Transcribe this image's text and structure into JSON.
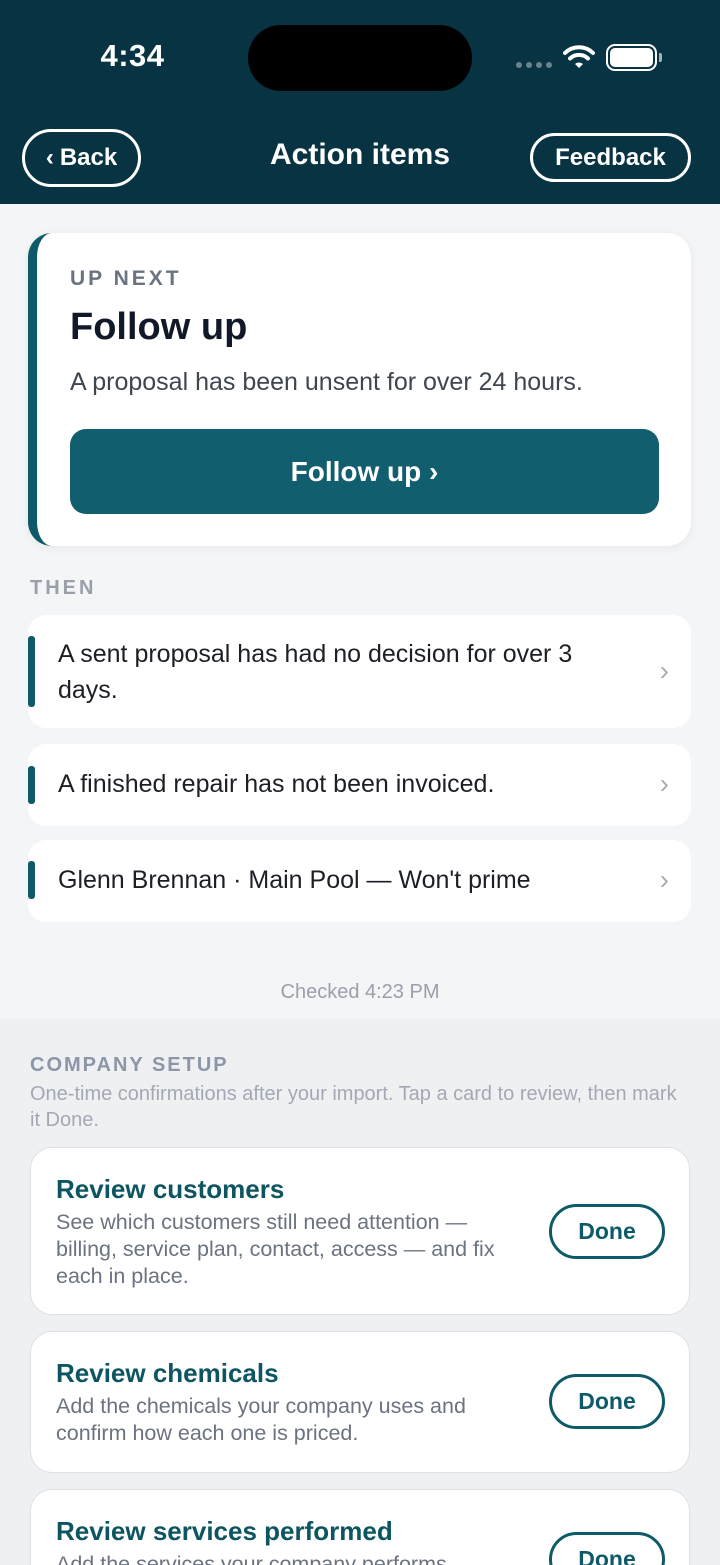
{
  "status_bar": {
    "time": "4:34"
  },
  "nav": {
    "back_label": "Back",
    "title": "Action items",
    "feedback_label": "Feedback"
  },
  "up_next": {
    "eyebrow": "UP NEXT",
    "title": "Follow up",
    "description": "A proposal has been unsent for over 24 hours.",
    "button_label": "Follow up ›"
  },
  "then": {
    "label": "THEN",
    "items": [
      {
        "text": "A sent proposal has had no decision for over 3 days."
      },
      {
        "text": "A finished repair has not been invoiced."
      },
      {
        "text": "Glenn Brennan · Main Pool — Won't prime"
      }
    ]
  },
  "checked_text": "Checked 4:23 PM",
  "company_setup": {
    "label": "COMPANY SETUP",
    "hint": "One-time confirmations after your import. Tap a card to review, then mark it Done.",
    "cards": [
      {
        "title": "Review customers",
        "description": "See which customers still need attention — billing, service plan, contact, access — and fix each in place.",
        "button_label": "Done"
      },
      {
        "title": "Review chemicals",
        "description": "Add the chemicals your company uses and confirm how each one is priced.",
        "button_label": "Done"
      },
      {
        "title": "Review services performed",
        "description": "Add the services your company performs",
        "button_label": "Done"
      }
    ]
  },
  "icons": {
    "back": "chevron-left-icon",
    "row": "chevron-right-icon",
    "wifi": "wifi-icon",
    "battery": "battery-icon"
  },
  "colors": {
    "header_bg": "#073342",
    "accent": "#0e5a68",
    "button_bg": "#115e6e"
  }
}
